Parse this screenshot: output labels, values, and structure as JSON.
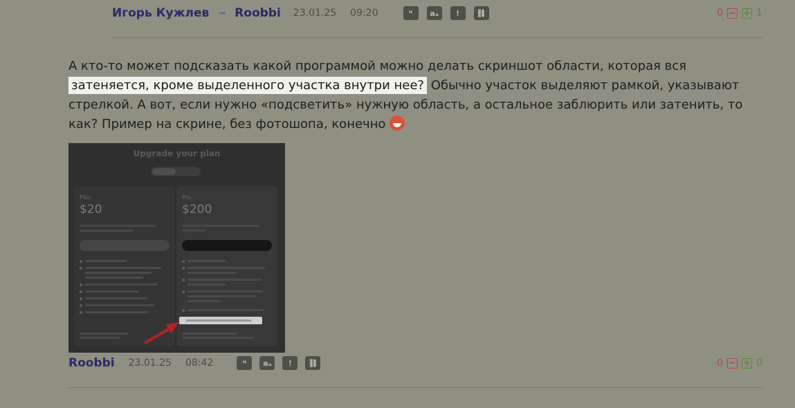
{
  "post_top": {
    "author": "Игорь Кужлев",
    "reply_to": "Roobbi",
    "date": "23.01.25",
    "time": "09:20",
    "votes": {
      "negative": "0",
      "positive": "1"
    }
  },
  "message": {
    "part1": "А кто-то может подсказать какой программой можно делать скриншот области, которая вся ",
    "highlight": "затеняется, кроме выделенного участка внутри нее?",
    "part2": " Обычно участок выделяют рамкой, указывают стрелкой. А вот, если нужно «подсветить» нужную область, а остальное заблюрить или затенить, то как? Пример на скрине, без фотошопа, конечно"
  },
  "attachment": {
    "title": "Upgrade your plan",
    "plans": [
      {
        "name": "Plus",
        "price": "$20"
      },
      {
        "name": "Pro",
        "price": "$200"
      }
    ]
  },
  "post_bottom": {
    "author": "Roobbi",
    "date": "23.01.25",
    "time": "08:42",
    "votes": {
      "negative": "0",
      "positive": "0"
    }
  },
  "icons": {
    "reply": "reply-arrow-icon",
    "tools": [
      "quote-icon",
      "translate-icon",
      "report-icon",
      "link-icon"
    ],
    "vote_minus": "minus-icon",
    "vote_plus": "plus-icon"
  },
  "colors": {
    "background": "#8f8f82",
    "author": "#2a2a6a",
    "vote_negative": "#b04a4a",
    "vote_positive": "#5c8a3a",
    "highlight": "#f2f2ec"
  }
}
